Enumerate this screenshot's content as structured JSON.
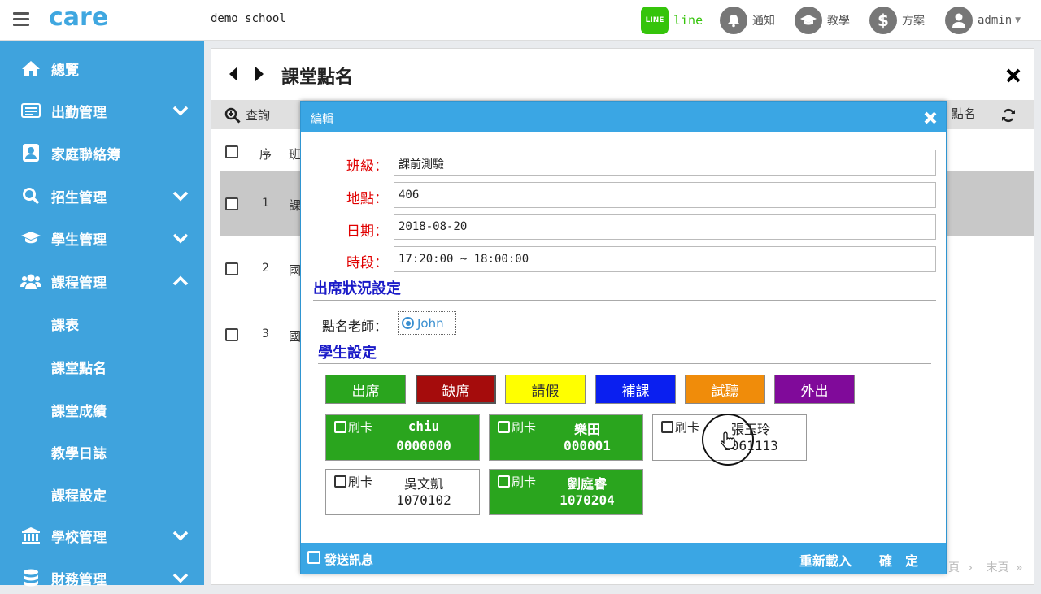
{
  "topbar": {
    "logo": "care",
    "school": "demo school",
    "line_icon": "LINE",
    "line_label": "line",
    "notify_label": "通知",
    "teach_label": "教學",
    "plan_label": "方案",
    "user_label": "admin"
  },
  "sidebar": {
    "items": [
      {
        "label": "總覽",
        "icon": "home-icon"
      },
      {
        "label": "出勤管理",
        "icon": "list-icon"
      },
      {
        "label": "家庭聯絡簿",
        "icon": "contact-icon"
      },
      {
        "label": "招生管理",
        "icon": "search-icon"
      },
      {
        "label": "學生管理",
        "icon": "graduation-cap-icon"
      },
      {
        "label": "課程管理",
        "icon": "users-icon"
      },
      {
        "label": "學校管理",
        "icon": "bank-icon"
      },
      {
        "label": "財務管理",
        "icon": "database-icon"
      }
    ],
    "subitems": [
      "課表",
      "課堂點名",
      "課堂成績",
      "教學日誌",
      "課程設定"
    ]
  },
  "page": {
    "title": "課堂點名",
    "query_label": "查詢",
    "rollcall_label": "點名",
    "col_no": "序",
    "col_class": "班",
    "rows": [
      {
        "no": "1",
        "cls": "課"
      },
      {
        "no": "2",
        "cls": "國"
      },
      {
        "no": "3",
        "cls": "國"
      }
    ],
    "pager_prev": "頁",
    "pager_last": "末頁"
  },
  "modal": {
    "title": "編輯",
    "fields": {
      "class_label": "班級：",
      "class_value": "課前測驗",
      "place_label": "地點：",
      "place_value": "406",
      "date_label": "日期：",
      "date_value": "2018-08-20",
      "time_label": "時段：",
      "time_value": "17:20:00 ~ 18:00:00"
    },
    "attendance_section": "出席狀況設定",
    "teacher_label": "點名老師：",
    "teacher_value": "John",
    "student_section": "學生設定",
    "status_buttons": [
      {
        "label": "出席",
        "color": "#2aa51e",
        "text": "#ffffff"
      },
      {
        "label": "缺席",
        "color": "#a50c0c",
        "text": "#ffffff"
      },
      {
        "label": "請假",
        "color": "#ffff00",
        "text": "#333333"
      },
      {
        "label": "補課",
        "color": "#0a1ff0",
        "text": "#ffffff"
      },
      {
        "label": "試聽",
        "color": "#f08c0a",
        "text": "#ffffff"
      },
      {
        "label": "外出",
        "color": "#800a9a",
        "text": "#ffffff"
      }
    ],
    "swipe_label": "刷卡",
    "students": [
      {
        "name": "chiu",
        "number": "0000000",
        "status": "present"
      },
      {
        "name": "樂田",
        "number": "000001",
        "status": "present"
      },
      {
        "name": "張玉玲",
        "number": "1061113",
        "status": "none"
      },
      {
        "name": "吳文凱",
        "number": "1070102",
        "status": "none"
      },
      {
        "name": "劉庭睿",
        "number": "1070204",
        "status": "present"
      }
    ],
    "send_message": "發送訊息",
    "reload": "重新載入",
    "confirm": "確　定"
  }
}
